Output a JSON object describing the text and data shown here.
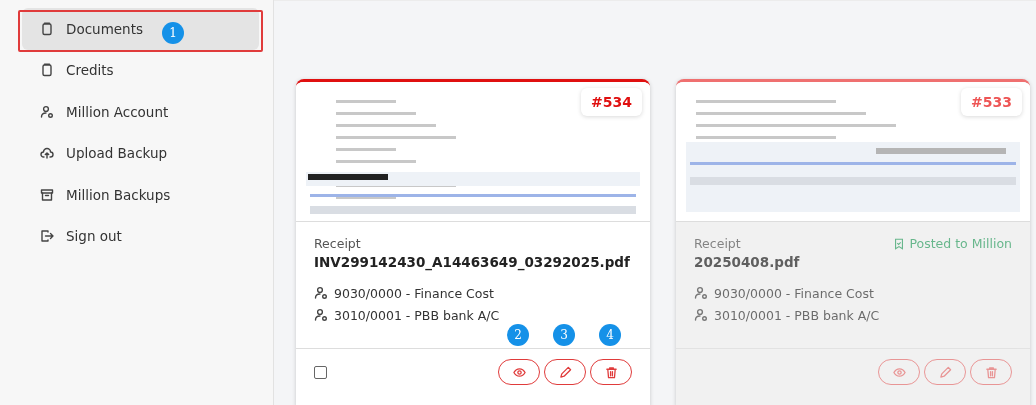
{
  "sidebar": {
    "items": [
      {
        "label": "Documents",
        "kind": "doc",
        "selected": true,
        "annotation": "1"
      },
      {
        "label": "Credits",
        "kind": "doc",
        "selected": false
      },
      {
        "label": "Million Account",
        "kind": "account",
        "selected": false
      },
      {
        "label": "Upload Backup",
        "kind": "upload",
        "selected": false
      },
      {
        "label": "Million Backups",
        "kind": "archive",
        "selected": false
      },
      {
        "label": "Sign out",
        "kind": "signout",
        "selected": false
      }
    ]
  },
  "cards": [
    {
      "number": "#534",
      "type": "Receipt",
      "filename": "INV299142430_A14463649_03292025.pdf",
      "posted": false,
      "preview": {
        "kind": "picture"
      },
      "accounts": [
        "9030/0000 - Finance Cost",
        "3010/0001 - PBB bank A/C"
      ],
      "checkbox": {
        "checked": false
      },
      "buttons": [
        {
          "kind": "view",
          "annotation": "2"
        },
        {
          "kind": "edit",
          "annotation": "3"
        },
        {
          "kind": "delete",
          "annotation": "4"
        }
      ]
    },
    {
      "number": "#533",
      "type": "Receipt",
      "filename": "20250408.pdf",
      "posted": true,
      "status": "Posted to Million",
      "preview": {
        "kind": "picture"
      },
      "accounts": [
        "9030/0000 - Finance Cost",
        "3010/0001 - PBB bank A/C"
      ],
      "buttons": [
        {
          "kind": "view"
        },
        {
          "kind": "edit"
        },
        {
          "kind": "delete"
        }
      ]
    }
  ]
}
